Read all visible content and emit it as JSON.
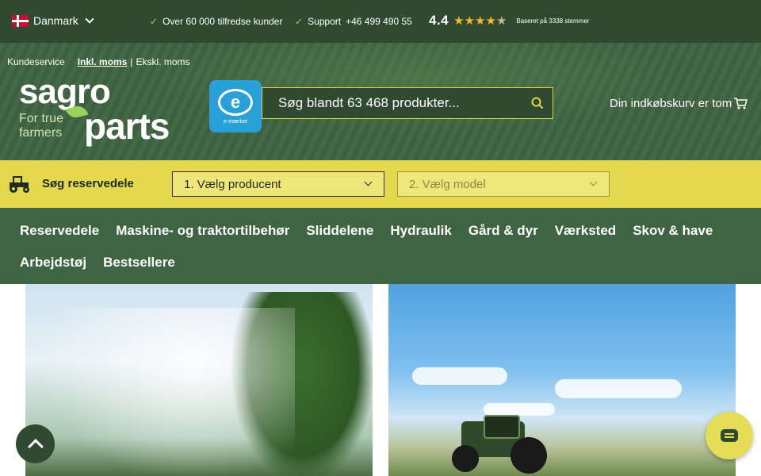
{
  "topbar": {
    "country": "Danmark",
    "usps": [
      "Over 60 000 tilfredse kunder",
      "Support",
      "+46 499 490 55"
    ],
    "rating": {
      "value": "4.4",
      "stars": 4.4,
      "note": "Baseret på 3338 stemmer"
    }
  },
  "header": {
    "links": {
      "service": "Kundeservice",
      "incl_vat": "Inkl. moms",
      "separator": "|",
      "excl_vat": "Ekskl. moms"
    },
    "logo": {
      "top": "sagro",
      "bottom": "parts",
      "tagline_1": "For true",
      "tagline_2": "farmers"
    },
    "trust_badge": "e-mærket",
    "search": {
      "placeholder": "Søg blandt 63 468 produkter..."
    },
    "cart": {
      "label": "Din indkøbskurv er tom"
    }
  },
  "finder": {
    "title": "Søg reservedele",
    "manufacturer_select": "1. Vælg producent",
    "model_select": "2. Vælg model"
  },
  "nav": {
    "items": [
      "Reservedele",
      "Maskine- og traktortilbehør",
      "Sliddelene",
      "Hydraulik",
      "Gård & dyr",
      "Værksted",
      "Skov & have",
      "Arbejdstøj",
      "Bestsellere"
    ]
  },
  "colors": {
    "dark_green": "#2f4a30",
    "green": "#3f6441",
    "yellow": "#e3d84e",
    "check": "#9bd25b",
    "star": "#f5b82e"
  }
}
